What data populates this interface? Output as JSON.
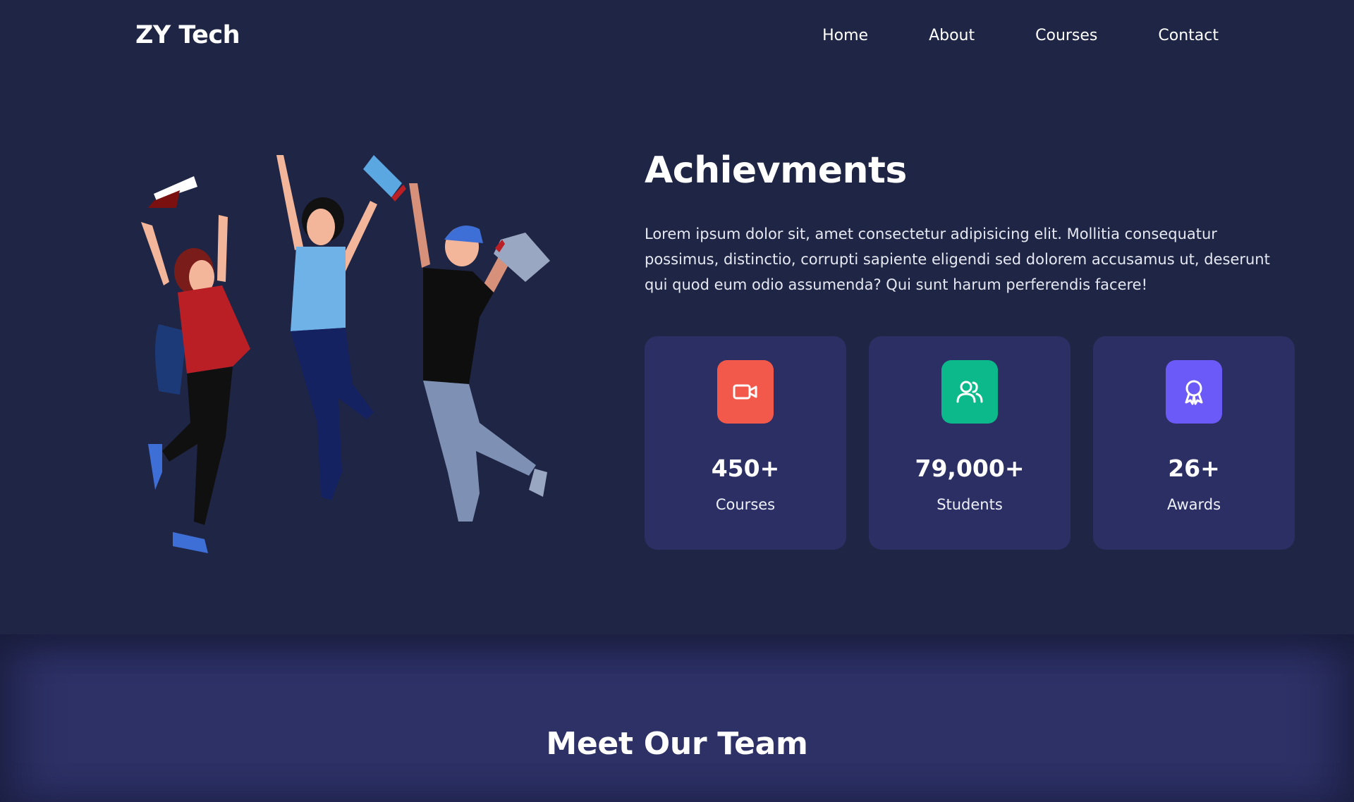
{
  "nav": {
    "logo": "ZY Tech",
    "links": [
      "Home",
      "About",
      "Courses",
      "Contact"
    ]
  },
  "achievements": {
    "title": "Achievments",
    "text": "Lorem ipsum dolor sit, amet consectetur adipisicing elit. Mollitia consequatur possimus, distinctio, corrupti sapiente eligendi sed dolorem accusamus ut, deserunt qui quod eum odio assumenda? Qui sunt harum perferendis facere!",
    "cards": [
      {
        "icon": "video-camera-icon",
        "color": "#f2594a",
        "value": "450+",
        "label": "Courses"
      },
      {
        "icon": "users-icon",
        "color": "#0cb98a",
        "value": "79,000+",
        "label": "Students"
      },
      {
        "icon": "award-icon",
        "color": "#6b5af7",
        "value": "26+",
        "label": "Awards"
      }
    ]
  },
  "team": {
    "title": "Meet Our Team"
  }
}
